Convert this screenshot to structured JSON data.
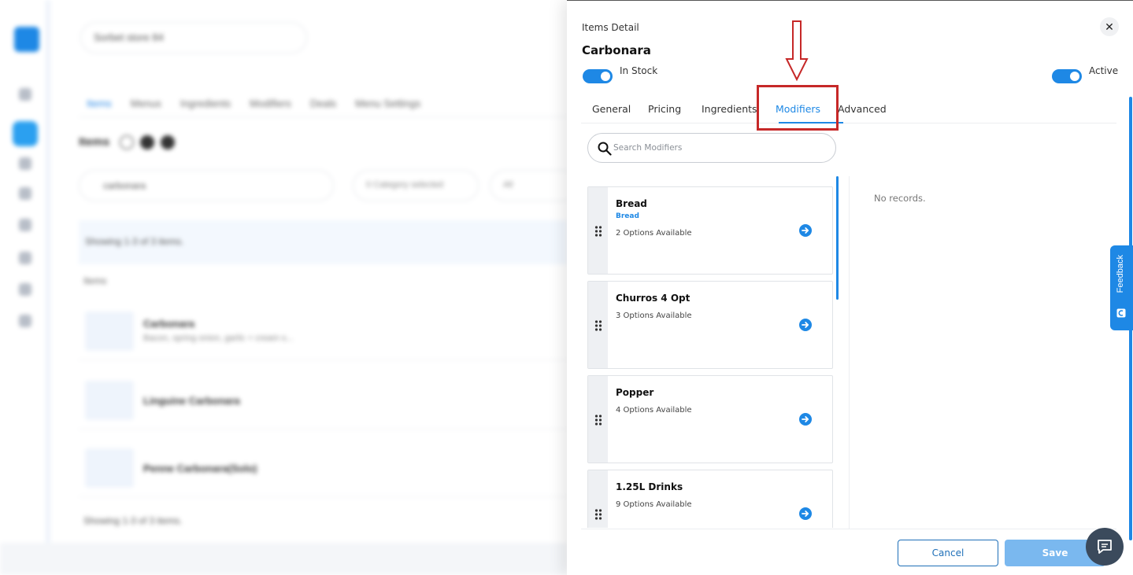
{
  "background": {
    "store_select": "Sorbet store 84",
    "tabs": [
      "Items",
      "Menus",
      "Ingredients",
      "Modifiers",
      "Deals",
      "Menu Settings"
    ],
    "section_title": "Items",
    "search_value": "carbonara",
    "category_filter": "0 Category selected",
    "all_filter": "All",
    "showing_text": "Showing 1-3 of 3 items.",
    "list_label": "Items",
    "rows": [
      {
        "name": "Carbonara",
        "desc": "Bacon, spring onion, garlic + cream s..."
      },
      {
        "name": "Linguine Carbonara",
        "desc": ""
      },
      {
        "name": "Penne Carbonara(Solo)",
        "desc": ""
      }
    ],
    "footer_text": "Showing 1-3 of 3 items."
  },
  "drawer": {
    "caption": "Items Detail",
    "title": "Carbonara",
    "in_stock_label": "In Stock",
    "active_label": "Active",
    "tabs": [
      {
        "label": "General"
      },
      {
        "label": "Pricing"
      },
      {
        "label": "Ingredients"
      },
      {
        "label": "Modifiers"
      },
      {
        "label": "Advanced"
      }
    ],
    "search_placeholder": "Search Modifiers",
    "modifiers": [
      {
        "name": "Bread",
        "sub": "Bread",
        "options": "2 Options Available"
      },
      {
        "name": "Churros 4 Opt",
        "sub": "",
        "options": "3 Options Available"
      },
      {
        "name": "Popper",
        "sub": "",
        "options": "4 Options Available"
      },
      {
        "name": "1.25L Drinks",
        "sub": "",
        "options": "9 Options Available"
      }
    ],
    "no_records": "No records.",
    "cancel_label": "Cancel",
    "save_label": "Save",
    "close_glyph": "✕"
  },
  "feedback_label": "Feedback",
  "colors": {
    "accent": "#1e88e5",
    "highlight": "#c62828",
    "save_disabled": "#7ab8ef"
  }
}
